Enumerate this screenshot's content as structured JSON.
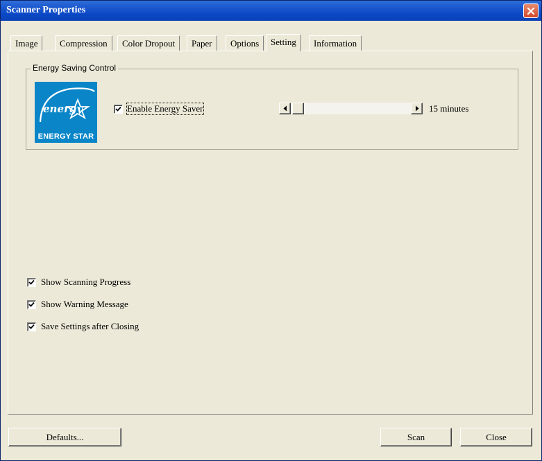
{
  "window": {
    "title": "Scanner Properties"
  },
  "tabs": [
    {
      "label": "Image"
    },
    {
      "label": "Compression"
    },
    {
      "label": "Color Dropout"
    },
    {
      "label": "Paper"
    },
    {
      "label": "Options"
    },
    {
      "label": "Setting",
      "active": true
    },
    {
      "label": "Information"
    }
  ],
  "energy": {
    "group_label": "Energy Saving Control",
    "logo_script": "energy",
    "logo_text": "ENERGY STAR",
    "enable_label": "Enable Energy Saver",
    "enable_checked": true,
    "delay_value": "15 minutes"
  },
  "options": [
    {
      "label": "Show Scanning Progress",
      "checked": true
    },
    {
      "label": "Show Warning Message",
      "checked": true
    },
    {
      "label": "Save Settings after Closing",
      "checked": true
    }
  ],
  "buttons": {
    "defaults": "Defaults...",
    "scan": "Scan",
    "close": "Close"
  },
  "colors": {
    "title_bar": "#0a47c4",
    "face": "#ece9d8",
    "logo_blue": "#0a86c8",
    "close_red": "#d3492a"
  }
}
